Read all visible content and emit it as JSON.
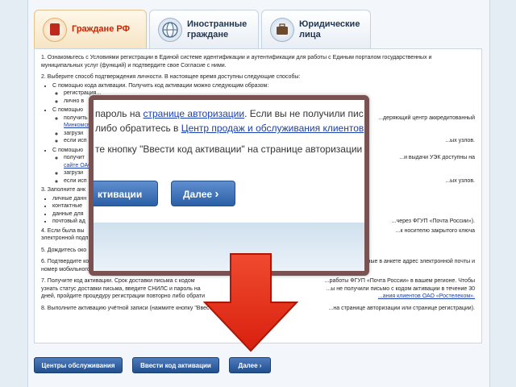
{
  "tabs": [
    {
      "label": "Граждане РФ"
    },
    {
      "label": "Иностранные граждане"
    },
    {
      "label": "Юридические лица"
    }
  ],
  "content": {
    "p1": "1. Ознакомьтесь с Условиями регистрации в Единой системе идентификации и аутентификации для работы с Единым порталом государственных и муниципальных услуг (функций) и подтвердите свое Согласие с ними.",
    "p2": "2. Выберите способ подтверждения личности. В настоящее время доступны следующие способы:",
    "p2_m1": "С помощью кода активации. Получить код активации можно следующим образом:",
    "p2_m1_a": "регистрация...",
    "p2_m1_b": "лично в",
    "p2_m2": "С помощью",
    "p2_m2_a": "получить",
    "p2_m2_a_tail": "...деряющий центр аккредитованный",
    "p2_m2_a_link": "Минкомсв",
    "p2_m2_b": "загрузи",
    "p2_m2_c": "если исп",
    "p2_m2_c_tail": "...ых узлов.",
    "p2_m3": "С помощью",
    "p2_m3_a": "получит",
    "p2_m3_a_tail": "...и выдачи УЭК доступны на",
    "p2_m3_a_link": "сайте ОАО",
    "p2_m3_b": "загрузи",
    "p2_m3_c": "если исп",
    "p2_m3_c_tail": "...ых узлов.",
    "p3": "3. Заполните анк",
    "p3_a": "личные данн",
    "p3_b": "контактные",
    "p3_c": "данные для",
    "p3_d": "почтовый ад",
    "p3_tail": "...через ФГУП «Почта России»).",
    "p4": "4. Если была вы",
    "p4_tail": "...к носителю закрытого ключа",
    "p4_b": "электронной подп",
    "p5": "5. Дождитесь око",
    "p6": "6. Подтвердите контактные данные с помощью кодов подтвержд",
    "p6_tail": "...ыли отправлены на указанные в анкете адрес электронной почты и",
    "p6_b": "номер мобильного телефона.",
    "p7": "7. Получите код активации. Срок доставки письма с кодом",
    "p7_tail": "...работы ФГУП «Почта России» в вашем регионе. Чтобы",
    "p7_b": "узнать статус доставки письма, введите СНИЛС и пароль на",
    "p7_b_tail": "...ы не получили письмо с кодом активации в течение 30",
    "p7_c": "дней, пройдите процедуру регистрации повторно либо обрати",
    "p7_c_link": "...ания клиентов ОАО «Ростелеком».",
    "p8": "8. Выполните активацию учётной записи (нажмите кнопку \"Ввести ко",
    "p8_tail": "...на странице авторизации или странице регистрации)."
  },
  "buttons": {
    "centers": "Центры обслуживания",
    "activation": "Ввести код активации",
    "next": "Далее"
  },
  "popup": {
    "line1_text": "пароль на ",
    "line1_link": "странице авторизации",
    "line1_tail": ". Если вы не получили пис",
    "line2_text": "либо обратитесь в ",
    "line2_link": "Центр продаж и обслуживания клиентов",
    "line3_text": "те кнопку \"Ввести код активации\" на странице авторизации и",
    "btn_left": "ктивации",
    "btn_next": "Далее"
  },
  "colors": {
    "accent": "#22508e",
    "arrow": "#e52d18",
    "popup_border": "#7a5252",
    "active_tab_text": "#cc2200"
  }
}
